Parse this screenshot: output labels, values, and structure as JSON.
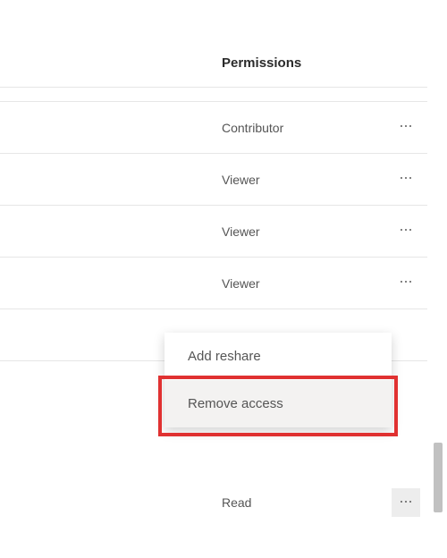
{
  "header": {
    "title": "Permissions"
  },
  "rows": [
    {
      "label": ""
    },
    {
      "label": "Contributor"
    },
    {
      "label": "Viewer"
    },
    {
      "label": "Viewer"
    },
    {
      "label": "Viewer"
    },
    {
      "label": "Read"
    }
  ],
  "menu": {
    "items": [
      {
        "label": "Add reshare"
      },
      {
        "label": "Remove access"
      }
    ]
  }
}
